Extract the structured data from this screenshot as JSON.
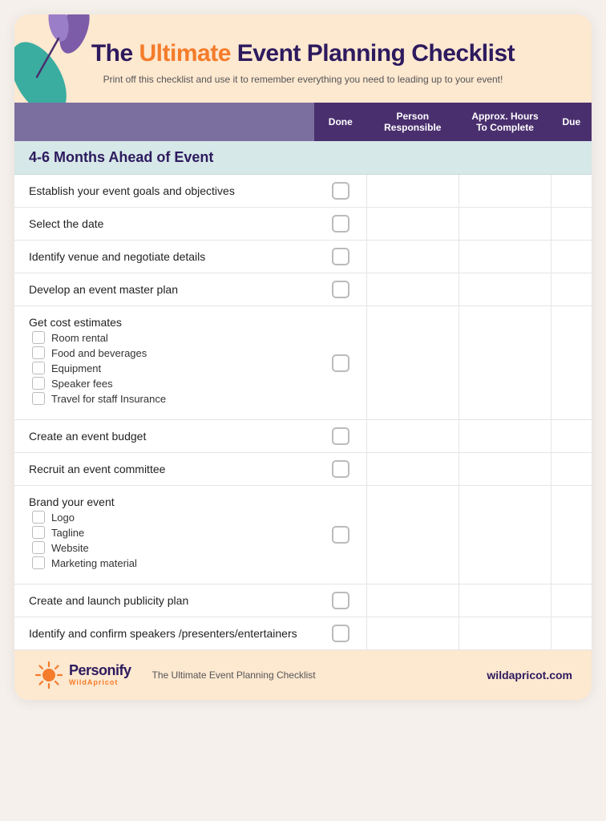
{
  "header": {
    "title_pre": "The ",
    "title_accent": "Ultimate",
    "title_post": " Event  Planning Checklist",
    "subtitle": "Print off this checklist and use it to remember everything you need to leading up to your event!"
  },
  "columns": {
    "task": "",
    "done": "Done",
    "person": "Person Responsible",
    "hours": "Approx. Hours To Complete",
    "due": "Due"
  },
  "sections": [
    {
      "section_label": "4-6 Months Ahead of Event",
      "rows": [
        {
          "task": "Establish your event goals and objectives",
          "bold": false,
          "has_checkbox": true,
          "sub_items": []
        },
        {
          "task": "Select the date",
          "bold": false,
          "has_checkbox": true,
          "sub_items": []
        },
        {
          "task": "Identify venue and negotiate details",
          "bold": false,
          "has_checkbox": true,
          "sub_items": []
        },
        {
          "task": "Develop an event master plan",
          "bold": false,
          "has_checkbox": true,
          "sub_items": []
        },
        {
          "task": "Get cost estimates",
          "bold": false,
          "has_checkbox": true,
          "sub_items": [
            "Room rental",
            "Food and beverages",
            "Equipment",
            "Speaker fees",
            "Travel for staff Insurance"
          ]
        },
        {
          "task": "Create an event budget",
          "bold": false,
          "has_checkbox": true,
          "sub_items": []
        },
        {
          "task": "Recruit an event committee",
          "bold": false,
          "has_checkbox": true,
          "sub_items": []
        },
        {
          "task": "Brand your event",
          "bold": false,
          "has_checkbox": true,
          "sub_items": [
            "Logo",
            "Tagline",
            "Website",
            "Marketing material"
          ]
        },
        {
          "task": "Create and launch publicity plan",
          "bold": false,
          "has_checkbox": true,
          "sub_items": []
        },
        {
          "task": "Identify and confirm speakers /presenters/entertainers",
          "bold": false,
          "has_checkbox": true,
          "sub_items": []
        }
      ]
    }
  ],
  "footer": {
    "brand_name": "Personify",
    "brand_sub": "WildApricot",
    "doc_title": "The Ultimate Event  Planning Checklist",
    "website": "wildapricot.com"
  }
}
